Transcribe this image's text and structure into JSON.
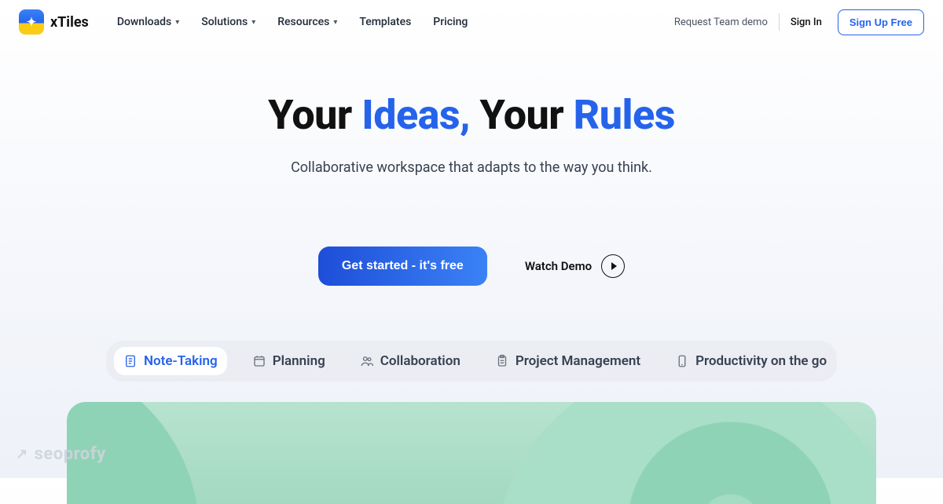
{
  "brand": {
    "name": "xTiles"
  },
  "nav": {
    "items": [
      {
        "label": "Downloads",
        "hasMenu": true
      },
      {
        "label": "Solutions",
        "hasMenu": true
      },
      {
        "label": "Resources",
        "hasMenu": true
      },
      {
        "label": "Templates",
        "hasMenu": false
      },
      {
        "label": "Pricing",
        "hasMenu": false
      }
    ]
  },
  "header": {
    "requestDemo": "Request Team demo",
    "signIn": "Sign In",
    "signUp": "Sign Up Free"
  },
  "hero": {
    "title_p1": "Your ",
    "title_accent1": "Ideas,",
    "title_p2": "Your ",
    "title_accent2": "Rules",
    "subtitle": "Collaborative workspace that adapts to the way you think.",
    "ctaPrimary": "Get started - it's free",
    "watchDemo": "Watch Demo"
  },
  "tabs": {
    "items": [
      {
        "label_pre": "Note-",
        "label_accent": "Taking",
        "icon": "doc-icon"
      },
      {
        "label": "Planning",
        "icon": "calendar-icon"
      },
      {
        "label": "Collaboration",
        "icon": "people-icon"
      },
      {
        "label": "Project Management",
        "icon": "clipboard-icon"
      },
      {
        "label": "Productivity on the go",
        "icon": "phone-icon"
      }
    ],
    "activeIndex": 0
  },
  "watermark": {
    "text": "seoprofy"
  },
  "colors": {
    "accent": "#2563eb",
    "green": "#a4d9c2"
  }
}
